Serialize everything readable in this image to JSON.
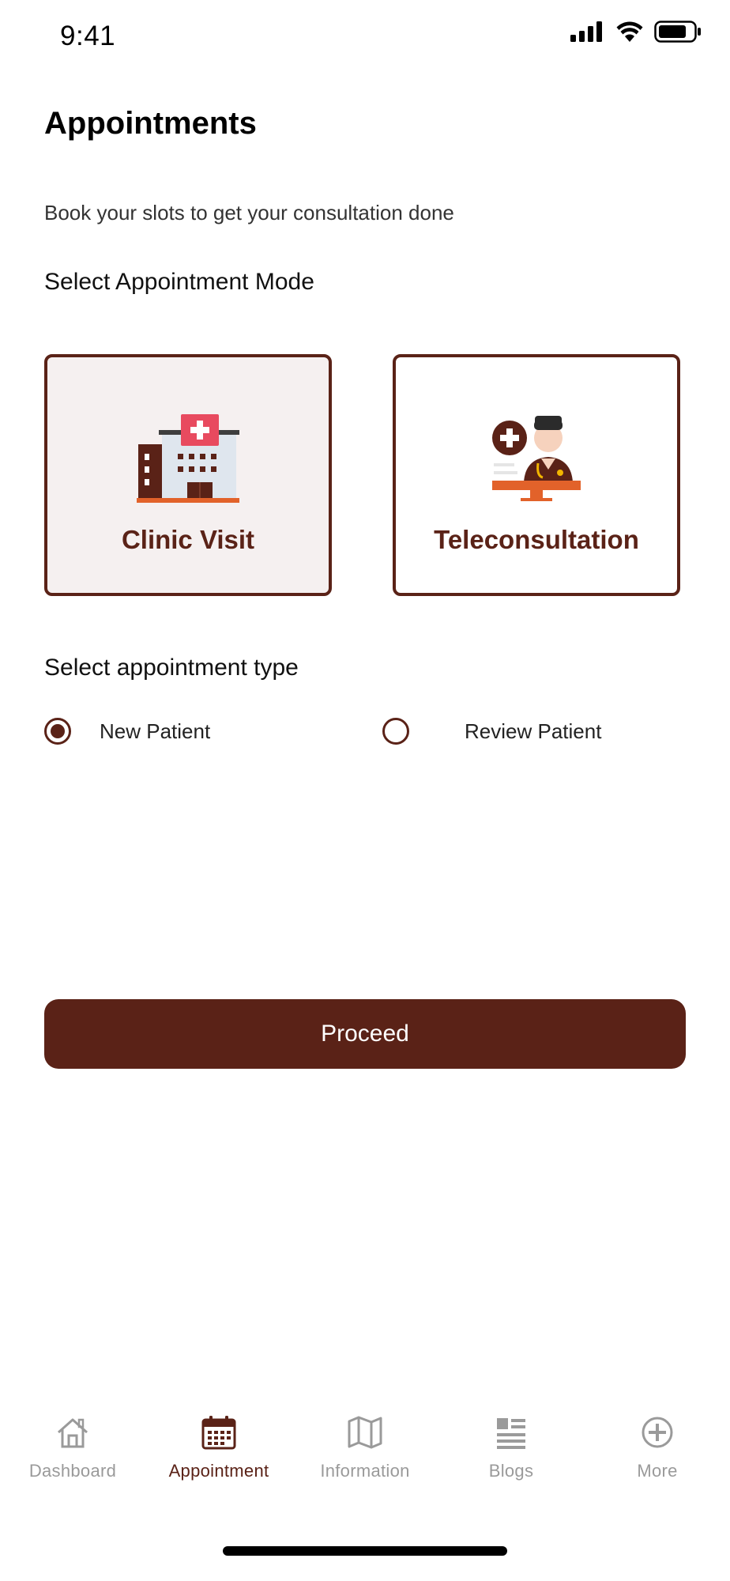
{
  "status_bar": {
    "time": "9:41"
  },
  "header": {
    "title": "Appointments",
    "subtitle": "Book your slots to get your consultation done"
  },
  "mode_section": {
    "label": "Select Appointment Mode",
    "options": [
      {
        "label": "Clinic Visit",
        "selected": true,
        "icon": "hospital-icon"
      },
      {
        "label": "Teleconsultation",
        "selected": false,
        "icon": "doctor-monitor-icon"
      }
    ]
  },
  "type_section": {
    "label": "Select appointment type",
    "options": [
      {
        "label": "New Patient",
        "selected": true
      },
      {
        "label": "Review Patient",
        "selected": false
      }
    ]
  },
  "proceed_label": "Proceed",
  "tabs": [
    {
      "label": "Dashboard",
      "icon": "home-icon",
      "active": false
    },
    {
      "label": "Appointment",
      "icon": "calendar-icon",
      "active": true
    },
    {
      "label": "Information",
      "icon": "map-icon",
      "active": false
    },
    {
      "label": "Blogs",
      "icon": "news-icon",
      "active": false
    },
    {
      "label": "More",
      "icon": "plus-circle-icon",
      "active": false
    }
  ],
  "colors": {
    "accent": "#5a2217",
    "selected_card_bg": "#f5f0f0",
    "inactive_tab": "#9a9a9a"
  }
}
